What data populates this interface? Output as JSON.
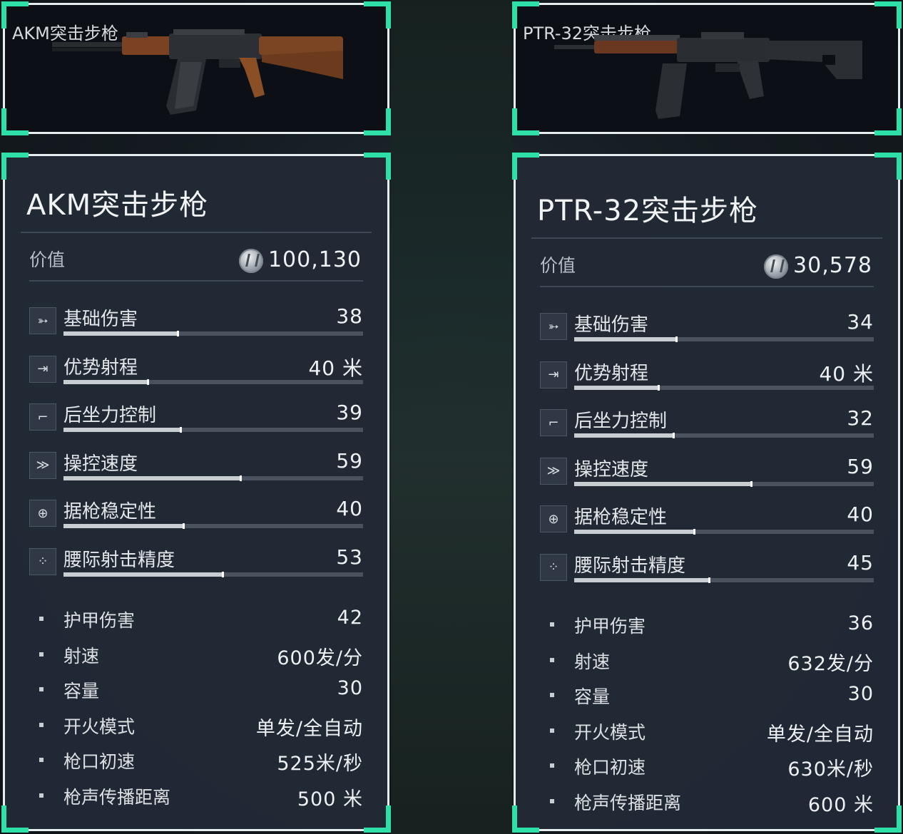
{
  "weapons": [
    {
      "card_name": "AKM突击步枪",
      "title": "AKM突击步枪",
      "value_label": "价值",
      "value": "100,130",
      "stats": [
        {
          "icon": "damage-icon",
          "label": "基础伤害",
          "value": "38",
          "level": 0.38
        },
        {
          "icon": "range-icon",
          "label": "优势射程",
          "value": "40 米",
          "level": 0.28
        },
        {
          "icon": "recoil-icon",
          "label": "后坐力控制",
          "value": "39",
          "level": 0.39
        },
        {
          "icon": "handling-icon",
          "label": "操控速度",
          "value": "59",
          "level": 0.59
        },
        {
          "icon": "crosshair-icon",
          "label": "据枪稳定性",
          "value": "40",
          "level": 0.4
        },
        {
          "icon": "hipfire-icon",
          "label": "腰际射击精度",
          "value": "53",
          "level": 0.53
        }
      ],
      "props": [
        {
          "label": "护甲伤害",
          "value": "42"
        },
        {
          "label": "射速",
          "value": "600发/分"
        },
        {
          "label": "容量",
          "value": "30"
        },
        {
          "label": "开火模式",
          "value": "单发/全自动"
        },
        {
          "label": "枪口初速",
          "value": "525米/秒"
        },
        {
          "label": "枪声传播距离",
          "value": "500 米"
        }
      ]
    },
    {
      "card_name": "PTR-32突击步枪",
      "title": "PTR-32突击步枪",
      "value_label": "价值",
      "value": "30,578",
      "stats": [
        {
          "icon": "damage-icon",
          "label": "基础伤害",
          "value": "34",
          "level": 0.34
        },
        {
          "icon": "range-icon",
          "label": "优势射程",
          "value": "40 米",
          "level": 0.28
        },
        {
          "icon": "recoil-icon",
          "label": "后坐力控制",
          "value": "32",
          "level": 0.33
        },
        {
          "icon": "handling-icon",
          "label": "操控速度",
          "value": "59",
          "level": 0.59
        },
        {
          "icon": "crosshair-icon",
          "label": "据枪稳定性",
          "value": "40",
          "level": 0.4
        },
        {
          "icon": "hipfire-icon",
          "label": "腰际射击精度",
          "value": "45",
          "level": 0.45
        }
      ],
      "props": [
        {
          "label": "护甲伤害",
          "value": "36"
        },
        {
          "label": "射速",
          "value": "632发/分"
        },
        {
          "label": "容量",
          "value": "30"
        },
        {
          "label": "开火模式",
          "value": "单发/全自动"
        },
        {
          "label": "枪口初速",
          "value": "630米/秒"
        },
        {
          "label": "枪声传播距离",
          "value": "600 米"
        }
      ]
    }
  ],
  "colors": {
    "accent": "#2ee0a8",
    "panel": "#222a36",
    "frame": "#e6eef0"
  }
}
